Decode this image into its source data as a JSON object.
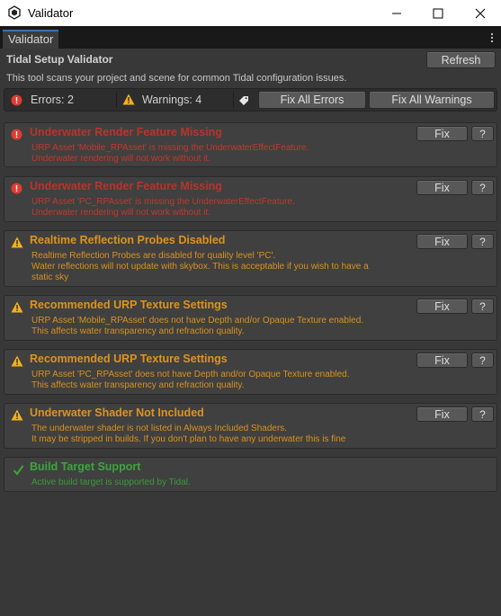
{
  "window": {
    "title": "Validator",
    "controls": {
      "minimize": "minimize-icon",
      "maximize": "maximize-icon",
      "close": "close-icon"
    }
  },
  "tab": {
    "label": "Validator"
  },
  "header": {
    "heading": "Tidal Setup Validator",
    "subtitle": "This tool scans your project and scene for common Tidal configuration issues.",
    "refresh_label": "Refresh"
  },
  "summary": {
    "errors_text": "Errors: 2",
    "warnings_text": "Warnings: 4",
    "fix_all_errors_label": "Fix All Errors",
    "fix_all_warnings_label": "Fix All Warnings"
  },
  "issues": [
    {
      "severity": "error",
      "title": "Underwater Render Feature Missing",
      "body_lines": [
        "URP Asset 'Mobile_RPAsset' is missing the UnderwaterEffectFeature.",
        "Underwater rendering will not work without it."
      ],
      "fix_label": "Fix",
      "help_label": "?"
    },
    {
      "severity": "error",
      "title": "Underwater Render Feature Missing",
      "body_lines": [
        "URP Asset 'PC_RPAsset' is missing the UnderwaterEffectFeature.",
        "Underwater rendering will not work without it."
      ],
      "fix_label": "Fix",
      "help_label": "?"
    },
    {
      "severity": "warning",
      "title": "Realtime Reflection Probes Disabled",
      "body_lines": [
        "Realtime Reflection Probes are disabled for quality level 'PC'.",
        "Water reflections will not update with skybox. This is acceptable if you wish to have a",
        "static sky"
      ],
      "fix_label": "Fix",
      "help_label": "?"
    },
    {
      "severity": "warning",
      "title": "Recommended URP Texture Settings",
      "body_lines": [
        "URP Asset 'Mobile_RPAsset' does not have Depth and/or Opaque Texture enabled.",
        "This affects water transparency and refraction quality."
      ],
      "fix_label": "Fix",
      "help_label": "?"
    },
    {
      "severity": "warning",
      "title": "Recommended URP Texture Settings",
      "body_lines": [
        "URP Asset 'PC_RPAsset' does not have Depth and/or Opaque Texture enabled.",
        "This affects water transparency and refraction quality."
      ],
      "fix_label": "Fix",
      "help_label": "?"
    },
    {
      "severity": "warning",
      "title": "Underwater Shader Not Included",
      "body_lines": [
        "The underwater shader is not listed in Always Included Shaders.",
        "It may be stripped in builds. If you don't plan to have any underwater this is fine"
      ],
      "fix_label": "Fix",
      "help_label": "?"
    },
    {
      "severity": "ok",
      "title": "Build Target Support",
      "body_lines": [
        "Active build target is supported by Tidal."
      ]
    }
  ],
  "colors": {
    "error": "#b8342a",
    "warning": "#dd9320",
    "ok": "#3aa63a",
    "tab_accent": "#3a72b0"
  }
}
